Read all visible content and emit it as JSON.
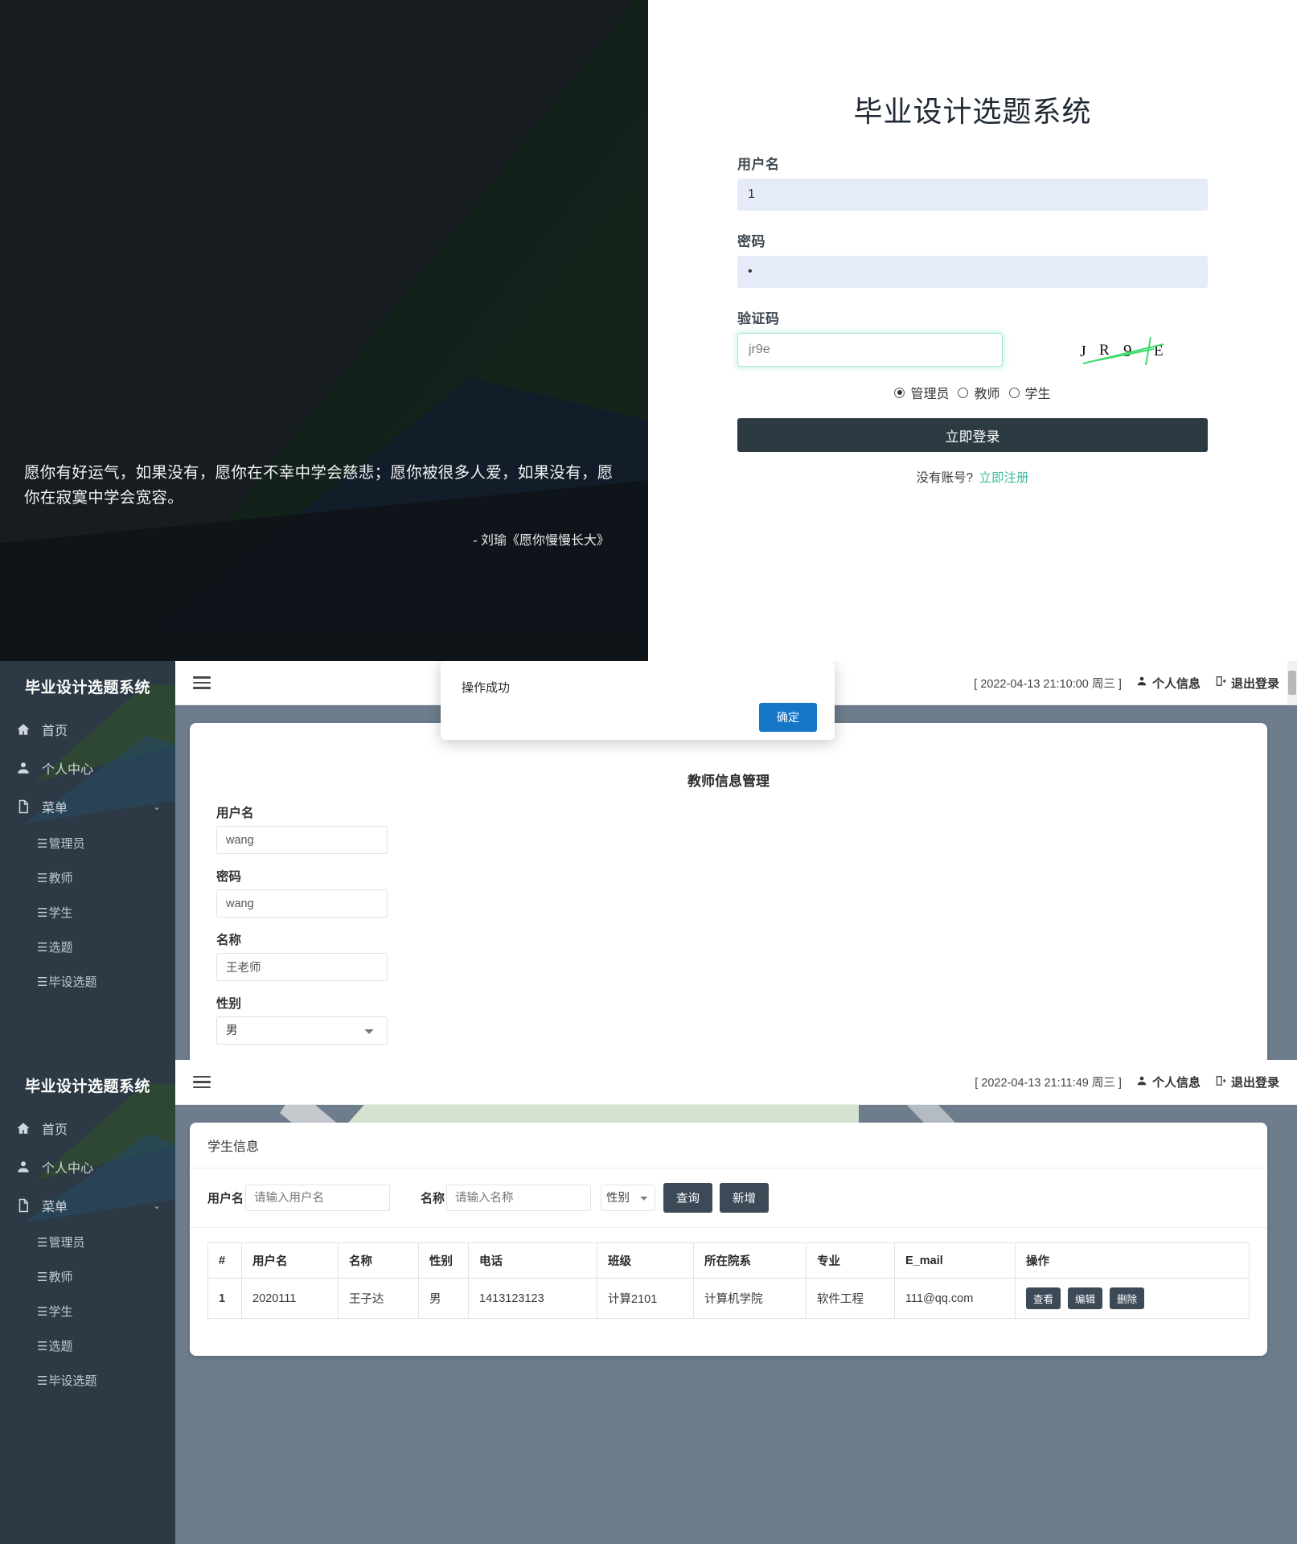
{
  "login": {
    "title": "毕业设计选题系统",
    "quote": "愿你有好运气，如果没有，愿你在不幸中学会慈悲；愿你被很多人爱，如果没有，愿你在寂寞中学会宽容。",
    "quote_author": "- 刘瑜《愿你慢慢长大》",
    "username_label": "用户名",
    "username_value": "1",
    "password_label": "密码",
    "password_value": "•",
    "captcha_label": "验证码",
    "captcha_value": "jr9e",
    "captcha_image_text": "JR9E",
    "roles": [
      {
        "label": "管理员",
        "selected": true
      },
      {
        "label": "教师",
        "selected": false
      },
      {
        "label": "学生",
        "selected": false
      }
    ],
    "login_button": "立即登录",
    "register_prompt": "没有账号?",
    "register_link": "立即注册",
    "accent_color": "#3fb9a0",
    "button_color": "#2c3a42"
  },
  "sidebar": {
    "brand": "毕业设计选题系统",
    "items": [
      {
        "label": "首页",
        "icon": "home-icon"
      },
      {
        "label": "个人中心",
        "icon": "user-icon"
      },
      {
        "label": "菜单",
        "icon": "file-icon",
        "chevron": "⌄"
      }
    ],
    "sub_items": [
      {
        "label": "管理员"
      },
      {
        "label": "教师"
      },
      {
        "label": "学生"
      },
      {
        "label": "选题"
      },
      {
        "label": "毕设选题"
      }
    ]
  },
  "panel_teacher": {
    "topbar": {
      "datetime": "[ 2022-04-13 21:10:00 周三 ]",
      "profile": "个人信息",
      "logout": "退出登录"
    },
    "page_title": "教师信息管理",
    "fields": [
      {
        "label": "用户名",
        "value": "wang",
        "type": "text"
      },
      {
        "label": "密码",
        "value": "wang",
        "type": "text"
      },
      {
        "label": "名称",
        "value": "王老师",
        "type": "text"
      },
      {
        "label": "性别",
        "value": "男",
        "type": "select"
      }
    ],
    "modal": {
      "message": "操作成功",
      "confirm": "确定",
      "confirm_color": "#1677c9"
    }
  },
  "panel_student": {
    "topbar": {
      "datetime": "[ 2022-04-13 21:11:49 周三 ]",
      "profile": "个人信息",
      "logout": "退出登录"
    },
    "card_title": "学生信息",
    "search": {
      "username_label": "用户名",
      "username_placeholder": "请输入用户名",
      "name_label": "名称",
      "name_placeholder": "请输入名称",
      "gender_label": "性别",
      "query_button": "查询",
      "add_button": "新增"
    },
    "table": {
      "headers": [
        "#",
        "用户名",
        "名称",
        "性别",
        "电话",
        "班级",
        "所在院系",
        "专业",
        "E_mail",
        "操作"
      ],
      "rows": [
        {
          "index": "1",
          "username": "2020111",
          "name": "王子达",
          "gender": "男",
          "phone": "1413123123",
          "class": "计算2101",
          "department": "计算机学院",
          "major": "软件工程",
          "email": "111@qq.com",
          "actions": [
            "查看",
            "编辑",
            "删除"
          ]
        }
      ]
    }
  }
}
